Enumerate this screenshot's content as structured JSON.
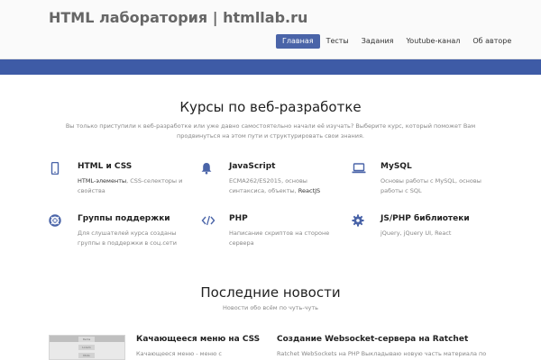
{
  "header": {
    "site_title": "HTML лаборатория | htmllab.ru",
    "nav": [
      "Главная",
      "Тесты",
      "Задания",
      "Youtube-канал",
      "Об авторе"
    ]
  },
  "courses": {
    "title": "Курсы по веб-разработке",
    "subtitle": "Вы только приступили к веб-разработке или уже давно самостоятельно начали её изучать? Выберите курс, который поможет Вам продвинуться на этом пути и структурировать свои знания.",
    "items": [
      {
        "title": "HTML и CSS",
        "text_dark": "HTML-элементы",
        "text": ", CSS-селекторы и свойства",
        "icon": "mobile-icon"
      },
      {
        "title": "JavaScript",
        "text_dark": "",
        "text": "ECMA262/ES2015, основы синтаксиса, объекты, ",
        "text_tail": "ReactJS",
        "icon": "bell-icon"
      },
      {
        "title": "MySQL",
        "text_dark": "",
        "text": "Основы работы с MySQL, основы работы с SQL",
        "icon": "laptop-icon"
      },
      {
        "title": "Группы поддержки",
        "text_dark": "",
        "text": "Для слушателей курса созданы группы в поддержки в соц.сети",
        "icon": "lifebuoy-icon"
      },
      {
        "title": "PHP",
        "text_dark": "",
        "text": "Написание скриптов на стороне сервера",
        "icon": "code-icon"
      },
      {
        "title": "JS/PHP библиотеки",
        "text_dark": "",
        "text": "jQuery, jQuery UI, React",
        "icon": "gear-icon"
      }
    ]
  },
  "news": {
    "title": "Последние новости",
    "subtitle": "Новости обо всём по чуть-чуть",
    "items": [
      {
        "title": "Качающееся меню на CSS",
        "text": "Качающееся меню - меню с"
      },
      {
        "title": "Создание Websocket-сервера на Ratchet",
        "text": "Ratchet WebSockets на PHP Выкладываю новую часть материала по"
      }
    ],
    "thumb_labels": [
      "Items",
      "Lorem",
      "Moto"
    ]
  },
  "colors": {
    "accent": "#3e5ba6",
    "icon": "#4a64a8"
  }
}
